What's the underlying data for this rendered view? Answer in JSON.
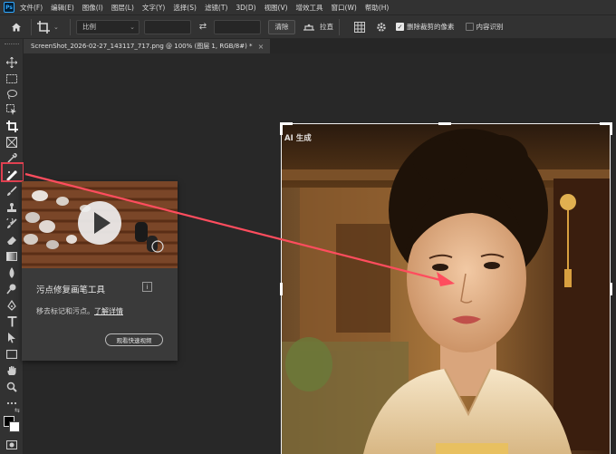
{
  "menubar": {
    "logo": "Ps",
    "items": [
      "文件(F)",
      "编辑(E)",
      "图像(I)",
      "图层(L)",
      "文字(Y)",
      "选择(S)",
      "滤镜(T)",
      "3D(D)",
      "视图(V)",
      "增效工具",
      "窗口(W)",
      "帮助(H)"
    ]
  },
  "options": {
    "ratio_label": "比例",
    "clear_label": "清除",
    "straighten_label": "拉直",
    "delete_pixels_label": "删除裁剪的像素",
    "delete_pixels_checked": true,
    "content_aware_label": "内容识别",
    "content_aware_checked": false
  },
  "document": {
    "tab_title": "ScreenShot_2026-02-27_143117_717.png @ 100% (图层 1, RGB/8#) *",
    "close_symbol": "×"
  },
  "canvas": {
    "watermark": "AI 生成"
  },
  "tooltip": {
    "title": "污点修复画笔工具",
    "info_symbol": "i",
    "description": "移去标记和污点。",
    "link": "了解详情",
    "button": "观看快速视频"
  },
  "colors": {
    "accent_highlight": "#e04050",
    "arrow": "#ff4d5e",
    "panel_bg": "#323232",
    "canvas_bg": "#282828"
  }
}
